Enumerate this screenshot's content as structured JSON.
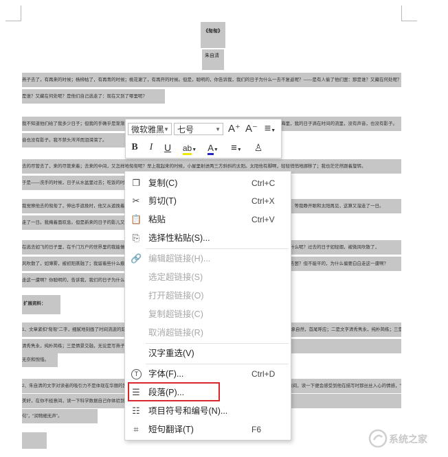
{
  "document": {
    "title": "《匆匆》",
    "author": "朱自清",
    "lines": [
      "燕子去了，有再来的时候；杨柳枯了，有再青的时候；桃花谢了，有再开的时候。但是，聪明的，你告诉我，我们的日子为什么一去不复返呢？——是有人偷了他们罢：那是谁？又藏在何处呢？是他们自己逃走了：现在又到了哪里呢？",
      "是谁？又藏在何处呢？是他们自己逃走了：现在又到了哪里呢？",
      "我不知道他们给了我多少日子；但我的手确乎是渐渐空虚了。在默默里算着，八千多日子已经从我手中溜去；像针尖上一滴水滴在大海里，我的日子滴在时间的流里，没有声音，也没有影子。",
      "音也没有影子。我不禁头涔涔而泪潸潸了。",
      "去的尽管去了，来的尽管来着；去来的中间，又怎样地匆匆呢？早上我起来的时候，小屋里射进两三方斜斜的太阳。太阳他有脚啊，轻轻悄悄地挪移了；我也茫茫然跟着旋转。",
      "于是——洗手的时候，日子从水盆里过去；吃饭的时候，日子从饭碗里过去",
      "我觉察他去的匆匆了，伸出手遮挽时，他又从遮挽着的手边过去，天黑时，我躺在床上，他便伶伶俐俐地从我身上跨过，从我脚边飞去了。等我睁开眼和太阳再见，这算又溜走了一日。",
      "走了一日。我掩着面叹息。但是新来的日子的影儿又开始在叹息里闪过了。",
      "在逃去如飞的日子里，在千门万户的世界里的我能做些什么呢？只有徘徊罢了，只有匆匆罢了；在八千多日的匆匆里，除徘徊外，又剩些什么呢？过去的日子如轻烟，被微风吹散了，",
      "风吹散了，如薄雾，被初阳蒸融了；我留着些什么痕迹呢？我何曾留着像游丝样的痕迹呢？我赤裸裸来到这世界，转眼间也将赤裸裸的回去罢？但不能平的，为什么偏要白白走这一遭啊？",
      "走这一遭啊？你聪明的，告诉我，我们的日子为什么一去不复返呢？",
      "扩展资料：",
      "1、文章紧扣“匆匆”二字，细腻地刻画了时间流逝的踪迹，表达了作者对时光流逝的无奈和惋惜。全文在结构上，首尾呼应，层次清楚，转承自然，首尾呼应；二是文字清秀隽永，纯朴简练；三是情景交融，无论是写燕子、杨柳、桃花，还是写太阳，都与作者的情感融为一体，处处流露出作者对时光流逝感到",
      "清秀隽永，纯朴简练；三是情景交融，无论是写燕子，都融为一体，处处流露出作者对时光流逝感到",
      "无奈和惋惜。",
      "2、朱自清的文字对读者的吸引力不是体现在华丽的辞藻，而是体现在质朴的感情上。朱自清的文字可以说是一幅朴实的画卷，让你不经意间，读一下便会感受到他在描写时那丝丝入心的情感，“朱自清的文字可以比成冬日里的一杯热茶”。",
      "美好，在你不经意间，读一下科学数据自己你体验到的“小小入心情”。朱自清的文字可以比成冬日里的",
      "句”，“润物细无声”。"
    ]
  },
  "minibar": {
    "font_name": "微软雅黑",
    "font_size": "七号",
    "grow_font": "A⁺",
    "shrink_font": "A⁻",
    "line_spacing": "≡",
    "bold": "B",
    "italic": "I",
    "underline": "U",
    "highlight": "ab",
    "font_color": "A",
    "align": "≡",
    "format_painter": "♙"
  },
  "context_menu": {
    "items": [
      {
        "label": "复制(C)",
        "shortcut": "Ctrl+C",
        "icon": "copy-icon",
        "enabled": true
      },
      {
        "label": "剪切(T)",
        "shortcut": "Ctrl+X",
        "icon": "scissors-icon",
        "enabled": true
      },
      {
        "label": "粘贴",
        "shortcut": "Ctrl+V",
        "icon": "paste-icon",
        "enabled": true
      },
      {
        "label": "选择性粘贴(S)...",
        "shortcut": "",
        "icon": "paste-special-icon",
        "enabled": true
      },
      {
        "label": "编辑超链接(H)...",
        "shortcut": "",
        "icon": "link-icon",
        "enabled": false
      },
      {
        "label": "选定超链接(S)",
        "shortcut": "",
        "icon": "",
        "enabled": false
      },
      {
        "label": "打开超链接(O)",
        "shortcut": "",
        "icon": "",
        "enabled": false
      },
      {
        "label": "复制超链接(C)",
        "shortcut": "",
        "icon": "",
        "enabled": false
      },
      {
        "label": "取消超链接(R)",
        "shortcut": "",
        "icon": "",
        "enabled": false
      },
      {
        "label": "汉字重选(V)",
        "shortcut": "",
        "icon": "",
        "enabled": true
      },
      {
        "label": "字体(F)...",
        "shortcut": "Ctrl+D",
        "icon": "font-icon",
        "enabled": true
      },
      {
        "label": "段落(P)...",
        "shortcut": "",
        "icon": "paragraph-icon",
        "enabled": true
      },
      {
        "label": "项目符号和编号(N)...",
        "shortcut": "",
        "icon": "list-icon",
        "enabled": true
      },
      {
        "label": "短句翻译(T)",
        "shortcut": "F6",
        "icon": "translate-icon",
        "enabled": true
      }
    ]
  },
  "watermark": {
    "text": "系统之家"
  },
  "colors": {
    "selection": "#c6c6c6",
    "highlight_box": "#d7272d",
    "disabled_text": "#a8a8a8"
  }
}
